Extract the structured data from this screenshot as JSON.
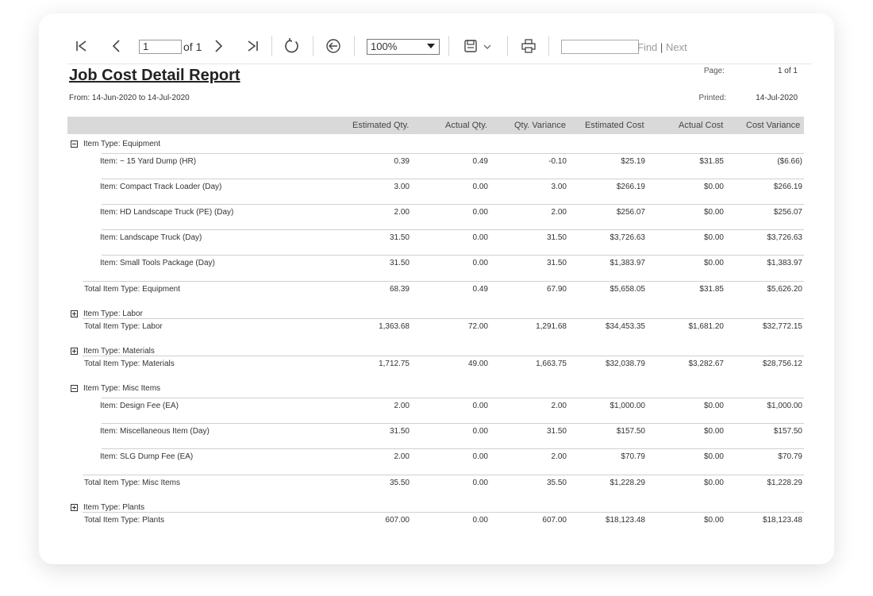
{
  "toolbar": {
    "page_value": "1",
    "page_of": "of 1",
    "zoom": "100%",
    "find_placeholder": "",
    "find_label": "Find",
    "find_separator": "|",
    "next_label": "Next"
  },
  "report": {
    "title": "Job Cost Detail Report",
    "date_range": "From: 14-Jun-2020 to 14-Jul-2020",
    "page_label": "Page:",
    "page_value": "1 of 1",
    "printed_label": "Printed:",
    "printed_value": "14-Jul-2020"
  },
  "columns": [
    "Estimated Qty.",
    "Actual Qty.",
    "Qty. Variance",
    "Estimated Cost",
    "Actual Cost",
    "Cost Variance"
  ],
  "rows": [
    {
      "kind": "group",
      "expanded": true,
      "label": "Item Type: Equipment"
    },
    {
      "kind": "item",
      "label": "Item: ~ 15 Yard Dump (HR)",
      "vals": [
        "0.39",
        "0.49",
        "-0.10",
        "$25.19",
        "$31.85",
        "($6.66)"
      ]
    },
    {
      "kind": "item",
      "label": "Item: Compact Track Loader (Day)",
      "vals": [
        "3.00",
        "0.00",
        "3.00",
        "$266.19",
        "$0.00",
        "$266.19"
      ]
    },
    {
      "kind": "item",
      "label": "Item: HD Landscape Truck (PE) (Day)",
      "vals": [
        "2.00",
        "0.00",
        "2.00",
        "$256.07",
        "$0.00",
        "$256.07"
      ]
    },
    {
      "kind": "item",
      "label": "Item: Landscape Truck (Day)",
      "vals": [
        "31.50",
        "0.00",
        "31.50",
        "$3,726.63",
        "$0.00",
        "$3,726.63"
      ]
    },
    {
      "kind": "item",
      "label": "Item: Small Tools Package (Day)",
      "vals": [
        "31.50",
        "0.00",
        "31.50",
        "$1,383.97",
        "$0.00",
        "$1,383.97"
      ]
    },
    {
      "kind": "total",
      "label": "Total Item Type: Equipment",
      "vals": [
        "68.39",
        "0.49",
        "67.90",
        "$5,658.05",
        "$31.85",
        "$5,626.20"
      ]
    },
    {
      "kind": "group",
      "expanded": false,
      "label": "Item Type: Labor"
    },
    {
      "kind": "total",
      "label": "Total Item Type: Labor",
      "vals": [
        "1,363.68",
        "72.00",
        "1,291.68",
        "$34,453.35",
        "$1,681.20",
        "$32,772.15"
      ]
    },
    {
      "kind": "group",
      "expanded": false,
      "label": "Item Type: Materials"
    },
    {
      "kind": "total",
      "label": "Total Item Type: Materials",
      "vals": [
        "1,712.75",
        "49.00",
        "1,663.75",
        "$32,038.79",
        "$3,282.67",
        "$28,756.12"
      ]
    },
    {
      "kind": "group",
      "expanded": true,
      "label": "Item Type: Misc Items"
    },
    {
      "kind": "item",
      "label": "Item: Design Fee (EA)",
      "vals": [
        "2.00",
        "0.00",
        "2.00",
        "$1,000.00",
        "$0.00",
        "$1,000.00"
      ]
    },
    {
      "kind": "item",
      "label": "Item: Miscellaneous Item (Day)",
      "vals": [
        "31.50",
        "0.00",
        "31.50",
        "$157.50",
        "$0.00",
        "$157.50"
      ]
    },
    {
      "kind": "item",
      "label": "Item: SLG Dump Fee (EA)",
      "vals": [
        "2.00",
        "0.00",
        "2.00",
        "$70.79",
        "$0.00",
        "$70.79"
      ]
    },
    {
      "kind": "total",
      "label": "Total Item Type: Misc Items",
      "vals": [
        "35.50",
        "0.00",
        "35.50",
        "$1,228.29",
        "$0.00",
        "$1,228.29"
      ]
    },
    {
      "kind": "group",
      "expanded": false,
      "label": "Item Type: Plants"
    },
    {
      "kind": "total",
      "label": "Total Item Type: Plants",
      "vals": [
        "607.00",
        "0.00",
        "607.00",
        "$18,123.48",
        "$0.00",
        "$18,123.48"
      ]
    }
  ],
  "icons": {
    "first": "first-page-icon",
    "prev": "prev-page-icon",
    "next": "next-page-icon",
    "last": "last-page-icon",
    "refresh": "refresh-icon",
    "back": "back-icon",
    "save": "save-icon",
    "print": "print-icon"
  }
}
